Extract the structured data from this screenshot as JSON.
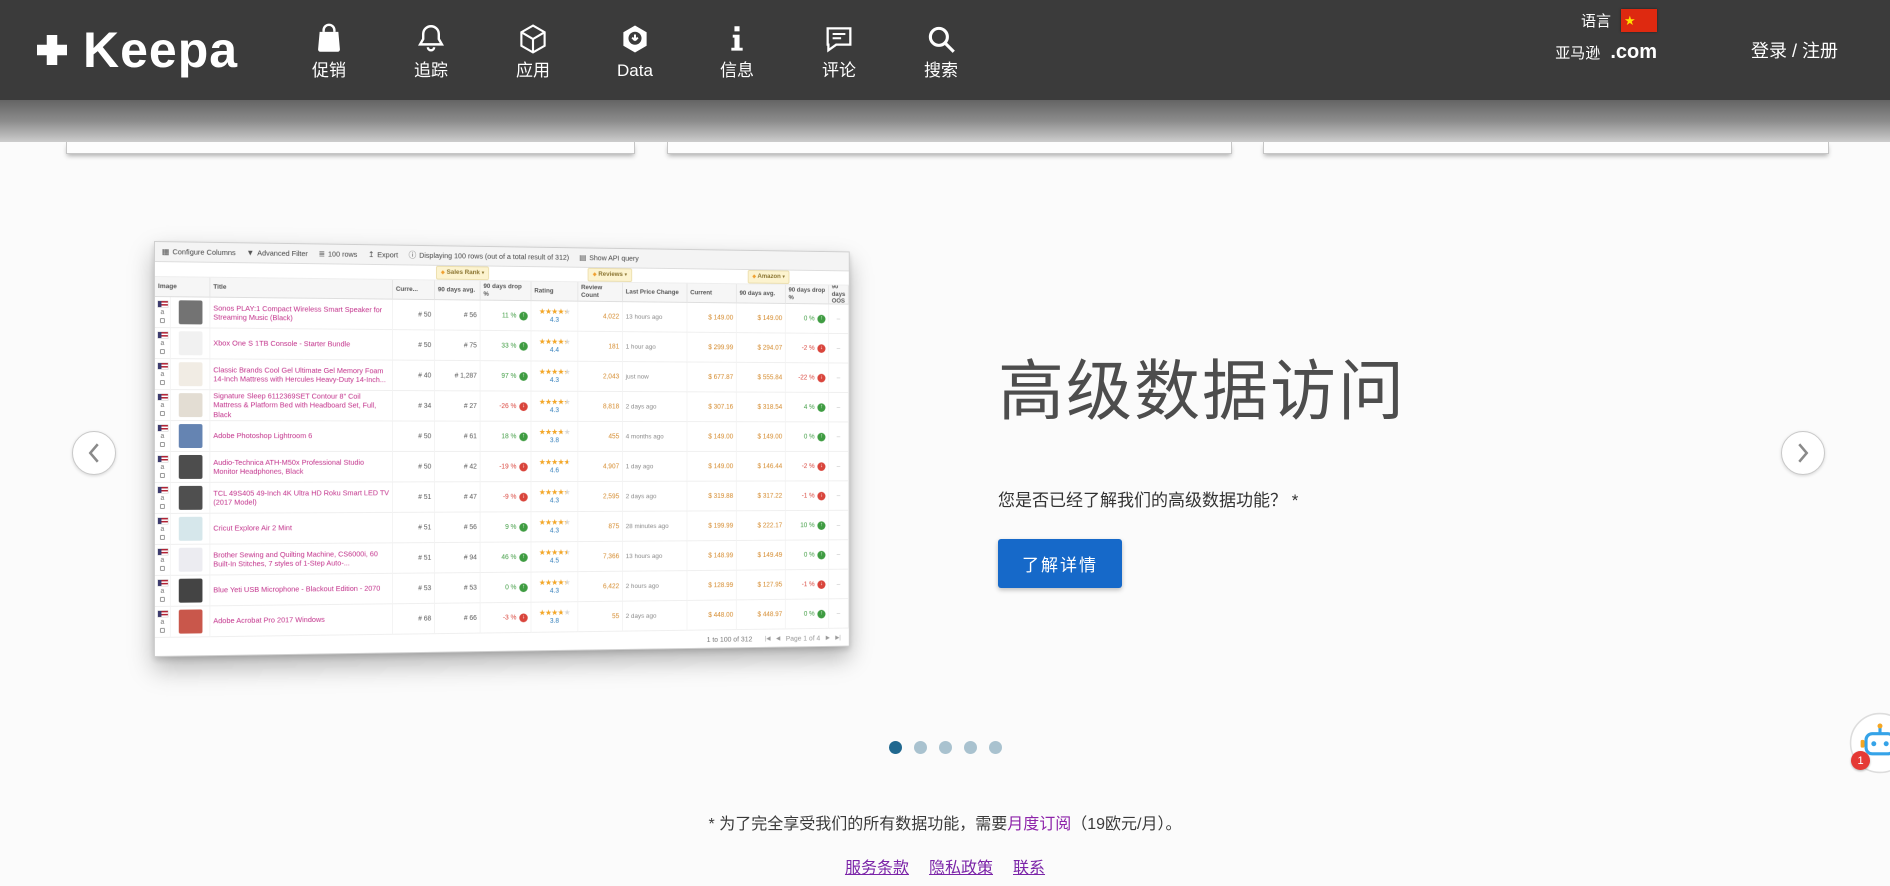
{
  "header": {
    "logo_text": "Keepa",
    "nav": [
      {
        "label": "促销",
        "icon": "shopping-bag-icon"
      },
      {
        "label": "追踪",
        "icon": "bell-icon"
      },
      {
        "label": "应用",
        "icon": "cube-icon"
      },
      {
        "label": "Data",
        "icon": "data-cube-icon"
      },
      {
        "label": "信息",
        "icon": "info-icon"
      },
      {
        "label": "评论",
        "icon": "comment-icon"
      },
      {
        "label": "搜索",
        "icon": "search-icon"
      }
    ],
    "language_label": "语言",
    "flag_icon": "china-flag-icon",
    "marketplace_label": "亚马逊",
    "domain_label": ".com",
    "auth_label": "登录 / 注册"
  },
  "slide": {
    "heading": "高级数据访问",
    "question": "您是否已经了解我们的高级数据功能？ *",
    "cta": "了解详情"
  },
  "carousel": {
    "dot_count": 5,
    "active_dot": 0
  },
  "screenshot": {
    "toolbar": [
      {
        "icon": "columns-icon",
        "label": "Configure Columns"
      },
      {
        "icon": "filter-icon",
        "label": "Advanced Filter"
      },
      {
        "icon": "rows-icon",
        "label": "100 rows"
      },
      {
        "icon": "export-icon",
        "label": "Export"
      },
      {
        "icon": "info-icon",
        "label": "Displaying 100 rows (out of a total result of 312)"
      },
      {
        "icon": "api-icon",
        "label": "Show API query"
      }
    ],
    "groups": [
      "Sales Rank",
      "Reviews",
      "Amazon"
    ],
    "columns": [
      "Image",
      "Title",
      "Curre...",
      "90 days avg.",
      "90 days drop %",
      "Rating",
      "Review Count",
      "Last Price Change",
      "Current",
      "90 days avg.",
      "90 days drop %",
      "90 days OOS"
    ],
    "rows": [
      {
        "title": "Sonos PLAY:1 Compact Wireless Smart Speaker for Streaming Music (Black)",
        "thumb": "#5a5a5a",
        "rank": "# 50",
        "rank_avg": "# 56",
        "rank_drop": "11 %",
        "rank_drop_dir": "up",
        "rating": "4.3",
        "reviews": "4,022",
        "change": "13 hours ago",
        "price": "$ 149.00",
        "price_avg": "$ 149.00",
        "price_drop": "0 %",
        "price_drop_dir": "up"
      },
      {
        "title": "Xbox One S 1TB Console - Starter Bundle",
        "thumb": "#efefef",
        "rank": "# 50",
        "rank_avg": "# 75",
        "rank_drop": "33 %",
        "rank_drop_dir": "up",
        "rating": "4.4",
        "reviews": "181",
        "change": "1 hour ago",
        "price": "$ 299.99",
        "price_avg": "$ 294.07",
        "price_drop": "-2 %",
        "price_drop_dir": "down"
      },
      {
        "title": "Classic Brands Cool Gel Ultimate Gel Memory Foam 14-Inch Mattress with Hercules Heavy-Duty 14-Inch...",
        "thumb": "#efe9df",
        "rank": "# 40",
        "rank_avg": "# 1,287",
        "rank_drop": "97 %",
        "rank_drop_dir": "up",
        "rating": "4.3",
        "reviews": "2,043",
        "change": "just now",
        "price": "$ 677.87",
        "price_avg": "$ 555.84",
        "price_drop": "-22 %",
        "price_drop_dir": "down"
      },
      {
        "title": "Signature Sleep 6112369SET Contour 8\" Coil Mattress & Platform Bed with Headboard Set, Full, Black",
        "thumb": "#ded7cb",
        "rank": "# 34",
        "rank_avg": "# 27",
        "rank_drop": "-26 %",
        "rank_drop_dir": "down",
        "rating": "4.3",
        "reviews": "8,818",
        "change": "2 days ago",
        "price": "$ 307.16",
        "price_avg": "$ 318.54",
        "price_drop": "4 %",
        "price_drop_dir": "up"
      },
      {
        "title": "Adobe Photoshop Lightroom 6",
        "thumb": "#4a6fa5",
        "rank": "# 50",
        "rank_avg": "# 61",
        "rank_drop": "18 %",
        "rank_drop_dir": "up",
        "rating": "3.8",
        "reviews": "455",
        "change": "4 months ago",
        "price": "$ 149.00",
        "price_avg": "$ 149.00",
        "price_drop": "0 %",
        "price_drop_dir": "up"
      },
      {
        "title": "Audio-Technica ATH-M50x Professional Studio Monitor Headphones, Black",
        "thumb": "#2e2e2e",
        "rank": "# 50",
        "rank_avg": "# 42",
        "rank_drop": "-19 %",
        "rank_drop_dir": "down",
        "rating": "4.6",
        "reviews": "4,907",
        "change": "1 day ago",
        "price": "$ 149.00",
        "price_avg": "$ 146.44",
        "price_drop": "-2 %",
        "price_drop_dir": "down"
      },
      {
        "title": "TCL 49S405 49-Inch 4K Ultra HD Roku Smart LED TV (2017 Model)",
        "thumb": "#303030",
        "rank": "# 51",
        "rank_avg": "# 47",
        "rank_drop": "-9 %",
        "rank_drop_dir": "down",
        "rating": "4.3",
        "reviews": "2,595",
        "change": "2 days ago",
        "price": "$ 319.88",
        "price_avg": "$ 317.22",
        "price_drop": "-1 %",
        "price_drop_dir": "down"
      },
      {
        "title": "Cricut Explore Air 2 Mint",
        "thumb": "#cfe3e8",
        "rank": "# 51",
        "rank_avg": "# 56",
        "rank_drop": "9 %",
        "rank_drop_dir": "up",
        "rating": "4.3",
        "reviews": "875",
        "change": "28 minutes ago",
        "price": "$ 199.99",
        "price_avg": "$ 222.17",
        "price_drop": "10 %",
        "price_drop_dir": "up"
      },
      {
        "title": "Brother Sewing and Quilting Machine, CS6000i, 60 Built-In Stitches, 7 styles of 1-Step Auto-...",
        "thumb": "#e9e9ef",
        "rank": "# 51",
        "rank_avg": "# 94",
        "rank_drop": "46 %",
        "rank_drop_dir": "up",
        "rating": "4.5",
        "reviews": "7,366",
        "change": "13 hours ago",
        "price": "$ 148.99",
        "price_avg": "$ 149.49",
        "price_drop": "0 %",
        "price_drop_dir": "up"
      },
      {
        "title": "Blue Yeti USB Microphone - Blackout Edition - 2070",
        "thumb": "#232323",
        "rank": "# 53",
        "rank_avg": "# 53",
        "rank_drop": "0 %",
        "rank_drop_dir": "up",
        "rating": "4.3",
        "reviews": "6,422",
        "change": "2 hours ago",
        "price": "$ 128.99",
        "price_avg": "$ 127.95",
        "price_drop": "-1 %",
        "price_drop_dir": "down"
      },
      {
        "title": "Adobe Acrobat Pro 2017 Windows",
        "thumb": "#c0392b",
        "rank": "# 68",
        "rank_avg": "# 66",
        "rank_drop": "-3 %",
        "rank_drop_dir": "down",
        "rating": "3.8",
        "reviews": "55",
        "change": "2 days ago",
        "price": "$ 448.00",
        "price_avg": "$ 448.97",
        "price_drop": "0 %",
        "price_drop_dir": "up"
      }
    ],
    "footer": {
      "range": "1 to 100 of 312",
      "page": "Page 1 of 4"
    }
  },
  "footnote": {
    "prefix": "* 为了完全享受我们的所有数据功能，需要",
    "link": "月度订阅",
    "suffix": "（19欧元/月）。"
  },
  "footer_links": [
    {
      "label": "服务条款"
    },
    {
      "label": "隐私政策"
    },
    {
      "label": "联系"
    }
  ],
  "chat": {
    "badge": "1"
  },
  "colors": {
    "header_bg": "#3b3b3b",
    "accent_blue": "#1669c9",
    "link_purple": "#8e24aa",
    "title_pink": "#c2308a",
    "price_orange": "#d4892a",
    "positive_green": "#3f9c42",
    "negative_red": "#d9453c",
    "dot_active": "#20688f",
    "dot_inactive": "#a9c2cf"
  }
}
